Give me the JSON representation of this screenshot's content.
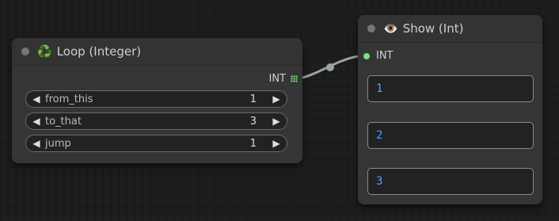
{
  "loop_node": {
    "title": "Loop (Integer)",
    "title_icon": "recycle-icon",
    "output_label": "INT",
    "widgets": [
      {
        "name": "from_this",
        "value": "1"
      },
      {
        "name": "to_that",
        "value": "3"
      },
      {
        "name": "jump",
        "value": "1"
      }
    ]
  },
  "show_node": {
    "title": "Show (Int)",
    "title_icon": "eye-icon",
    "input_label": "INT",
    "values": [
      "1",
      "2",
      "3"
    ]
  },
  "colors": {
    "canvas": "#1e1e1e",
    "node_body": "#353535",
    "connection_green": "#7fe07f",
    "value_text": "#4aa3ff",
    "link": "#9aa59a"
  }
}
